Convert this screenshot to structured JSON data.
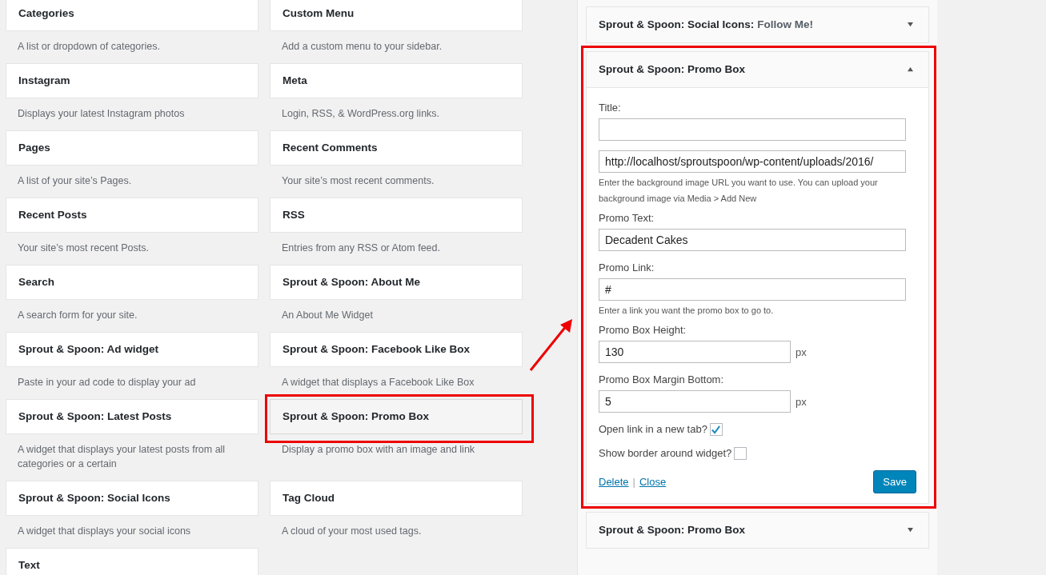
{
  "available_widgets": [
    {
      "title": "Categories",
      "description": "A list or dropdown of categories.",
      "highlighted": false
    },
    {
      "title": "Custom Menu",
      "description": "Add a custom menu to your sidebar.",
      "highlighted": false
    },
    {
      "title": "Instagram",
      "description": "Displays your latest Instagram photos",
      "highlighted": false
    },
    {
      "title": "Meta",
      "description": "Login, RSS, & WordPress.org links.",
      "highlighted": false
    },
    {
      "title": "Pages",
      "description": "A list of your site’s Pages.",
      "highlighted": false
    },
    {
      "title": "Recent Comments",
      "description": "Your site’s most recent comments.",
      "highlighted": false
    },
    {
      "title": "Recent Posts",
      "description": "Your site’s most recent Posts.",
      "highlighted": false
    },
    {
      "title": "RSS",
      "description": "Entries from any RSS or Atom feed.",
      "highlighted": false
    },
    {
      "title": "Search",
      "description": "A search form for your site.",
      "highlighted": false
    },
    {
      "title": "Sprout & Spoon: About Me",
      "description": "An About Me Widget",
      "highlighted": false
    },
    {
      "title": "Sprout & Spoon: Ad widget",
      "description": "Paste in your ad code to display your ad",
      "highlighted": false
    },
    {
      "title": "Sprout & Spoon: Facebook Like Box",
      "description": "A widget that displays a Facebook Like Box",
      "highlighted": false
    },
    {
      "title": "Sprout & Spoon: Latest Posts",
      "description": "A widget that displays your latest posts from all categories or a certain",
      "highlighted": false
    },
    {
      "title": "Sprout & Spoon: Promo Box",
      "description": "Display a promo box with an image and link",
      "highlighted": true
    },
    {
      "title": "Sprout & Spoon: Social Icons",
      "description": "A widget that displays your social icons",
      "highlighted": false
    },
    {
      "title": "Tag Cloud",
      "description": "A cloud of your most used tags.",
      "highlighted": false
    },
    {
      "title": "Text",
      "highlighted": false
    }
  ],
  "sidebar_widgets": [
    {
      "title": "Sprout & Spoon: Social Icons:",
      "instance_title": "Follow Me!",
      "expanded": false,
      "highlighted": false
    },
    {
      "title": "Sprout & Spoon: Promo Box",
      "expanded": true,
      "highlighted": true,
      "form": {
        "fields": [
          {
            "kind": "text",
            "label": "Title:"
          },
          {
            "kind": "text",
            "value": "http://localhost/sproutspoon/wp-content/uploads/2016/",
            "hint": "Enter the background image URL you want to use. You can upload your background image via Media > Add New"
          },
          {
            "kind": "text",
            "label": "Promo Text:",
            "value": "Decadent Cakes"
          },
          {
            "kind": "text",
            "label": "Promo Link:",
            "value": "#",
            "hint": "Enter a link you want the promo box to go to."
          },
          {
            "kind": "number",
            "label": "Promo Box Height:",
            "value": "130",
            "unit": "px"
          },
          {
            "kind": "number",
            "label": "Promo Box Margin Bottom:",
            "value": "5",
            "unit": "px"
          },
          {
            "kind": "checkbox",
            "label": "Open link in a new tab?",
            "checked": true
          },
          {
            "kind": "checkbox",
            "label": "Show border around widget?",
            "checked": false
          }
        ],
        "delete_link": "Delete",
        "separator": "|",
        "close_link": "Close",
        "save_button": "Save"
      }
    },
    {
      "title": "Sprout & Spoon: Promo Box",
      "expanded": false,
      "highlighted": false
    }
  ]
}
